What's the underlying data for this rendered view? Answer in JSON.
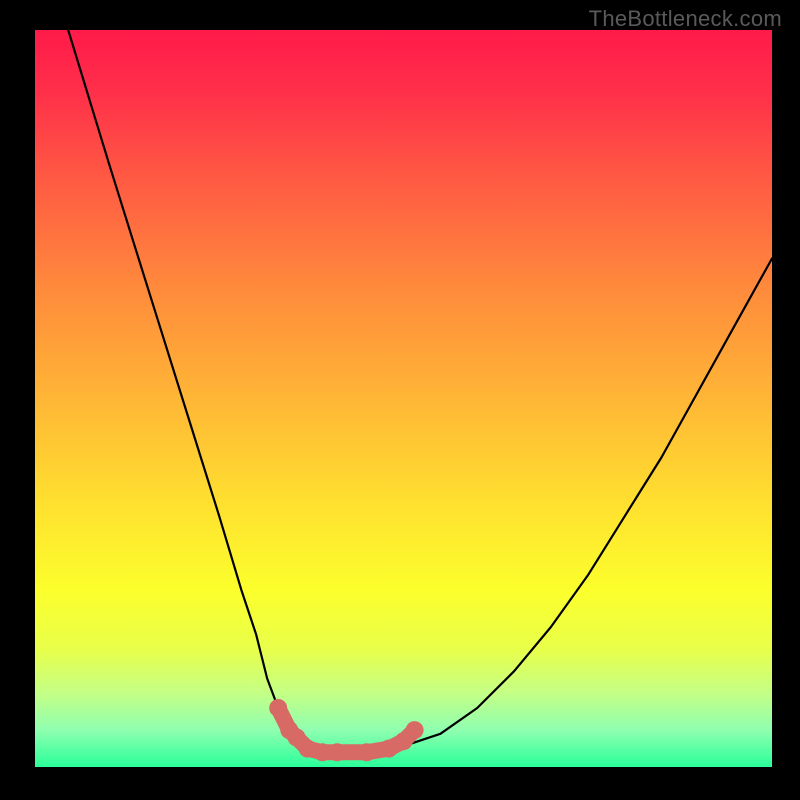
{
  "watermark": "TheBottleneck.com",
  "chart_data": {
    "type": "line",
    "title": "",
    "xlabel": "",
    "ylabel": "",
    "xlim": [
      0,
      1
    ],
    "ylim": [
      0,
      1
    ],
    "note": "axes unlabeled; values are normalized plot coordinates (0–1 on each axis)",
    "series": [
      {
        "name": "black-curve",
        "x": [
          0.045,
          0.1,
          0.15,
          0.2,
          0.25,
          0.28,
          0.3,
          0.315,
          0.33,
          0.345,
          0.355,
          0.37,
          0.39,
          0.41,
          0.45,
          0.49,
          0.55,
          0.6,
          0.65,
          0.7,
          0.75,
          0.8,
          0.85,
          0.9,
          0.95,
          1.0
        ],
        "y": [
          1.0,
          0.82,
          0.66,
          0.5,
          0.34,
          0.24,
          0.18,
          0.12,
          0.08,
          0.05,
          0.035,
          0.025,
          0.02,
          0.02,
          0.02,
          0.025,
          0.045,
          0.08,
          0.13,
          0.19,
          0.26,
          0.34,
          0.42,
          0.51,
          0.6,
          0.69
        ]
      }
    ],
    "highlighted_region": {
      "name": "valley-dots",
      "x": [
        0.33,
        0.345,
        0.355,
        0.37,
        0.39,
        0.41,
        0.45,
        0.48,
        0.5,
        0.515
      ],
      "y": [
        0.08,
        0.05,
        0.04,
        0.025,
        0.02,
        0.02,
        0.02,
        0.025,
        0.035,
        0.05
      ]
    },
    "background_gradient": {
      "direction": "top-to-bottom",
      "stops": [
        {
          "pos": 0.0,
          "color": "#ff1a4a"
        },
        {
          "pos": 0.5,
          "color": "#ffb636"
        },
        {
          "pos": 0.76,
          "color": "#fcff2c"
        },
        {
          "pos": 1.0,
          "color": "#2aff9a"
        }
      ]
    }
  }
}
